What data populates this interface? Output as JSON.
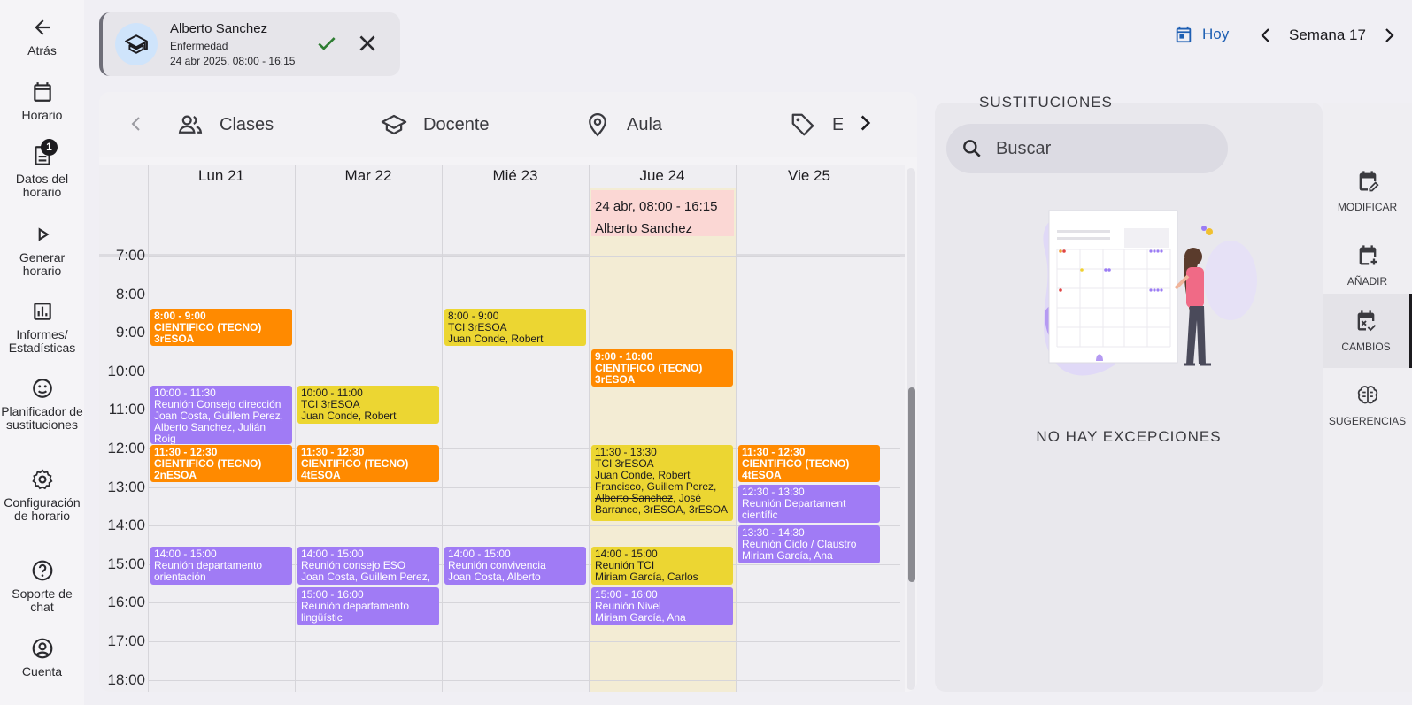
{
  "nav": {
    "back": "Atrás",
    "schedule": "Horario",
    "schedule_data": "Datos del horario",
    "schedule_data_badge": "1",
    "generate": "Generar horario",
    "reports": "Informes/ Estadísticas",
    "planner": "Planificador de sustituciones",
    "config": "Configuración de horario",
    "support": "Soporte de chat",
    "account": "Cuenta"
  },
  "notification": {
    "name": "Alberto Sanchez",
    "reason": "Enfermedad",
    "when": "24 abr 2025, 08:00 - 16:15"
  },
  "toolbar": {
    "today": "Hoy",
    "week": "Semana 17"
  },
  "filters": [
    "Clases",
    "Docente",
    "Aula",
    "Et"
  ],
  "calendar": {
    "days": [
      "Lun 21",
      "Mar 22",
      "Mié 23",
      "Jue 24",
      "Vie 25"
    ],
    "hours": [
      "7:00",
      "8:00",
      "9:00",
      "10:00",
      "11:00",
      "12:00",
      "13:00",
      "14:00",
      "15:00",
      "16:00",
      "17:00",
      "18:00"
    ],
    "allday": {
      "line1": "24 abr, 08:00 - 16:15",
      "line2": "Alberto Sanchez"
    },
    "events": [
      {
        "day": 0,
        "start": 8.37,
        "end": 9.37,
        "color": "orange",
        "lines": [
          "8:00 - 9:00",
          "CIENTIFICO (TECNO)",
          "3rESOA"
        ]
      },
      {
        "day": 0,
        "start": 10.37,
        "end": 11.9,
        "color": "purple",
        "lines": [
          "10:00 - 11:30",
          "Reunión Consejo dirección",
          "Joan Costa, Guillem Perez,",
          "Alberto Sanchez, Julián",
          "Roig"
        ]
      },
      {
        "day": 0,
        "start": 11.9,
        "end": 12.9,
        "color": "orange",
        "lines": [
          "11:30 - 12:30",
          "CIENTIFICO (TECNO)",
          "2nESOA"
        ]
      },
      {
        "day": 0,
        "start": 14.55,
        "end": 15.55,
        "color": "purple",
        "lines": [
          "14:00 - 15:00",
          "Reunión departamento",
          "orientación"
        ]
      },
      {
        "day": 1,
        "start": 10.37,
        "end": 11.37,
        "color": "yellow",
        "lines": [
          "10:00 - 11:00",
          "TCI 3rESOA",
          "Juan Conde, Robert"
        ]
      },
      {
        "day": 1,
        "start": 11.9,
        "end": 12.9,
        "color": "orange",
        "lines": [
          "11:30 - 12:30",
          "CIENTIFICO (TECNO)",
          "4tESOA"
        ]
      },
      {
        "day": 1,
        "start": 14.55,
        "end": 15.55,
        "color": "purple",
        "lines": [
          "14:00 - 15:00",
          "Reunión consejo ESO",
          "Joan Costa, Guillem Perez,"
        ]
      },
      {
        "day": 1,
        "start": 15.6,
        "end": 16.6,
        "color": "purple",
        "lines": [
          "15:00 - 16:00",
          "Reunión departamento",
          "lingüístic"
        ]
      },
      {
        "day": 2,
        "start": 8.37,
        "end": 9.37,
        "color": "yellow",
        "lines": [
          "8:00 - 9:00",
          "TCI 3rESOA",
          "Juan Conde, Robert"
        ]
      },
      {
        "day": 2,
        "start": 14.55,
        "end": 15.55,
        "color": "purple",
        "lines": [
          "14:00 - 15:00",
          "Reunión convivencia",
          "Joan Costa, Alberto"
        ]
      },
      {
        "day": 3,
        "start": 9.42,
        "end": 10.42,
        "color": "orange",
        "lines": [
          "9:00 - 10:00",
          "CIENTIFICO (TECNO)",
          "3rESOA"
        ]
      },
      {
        "day": 3,
        "start": 11.9,
        "end": 13.9,
        "color": "yellow",
        "lines": [
          "11:30 - 13:30",
          "TCI 3rESOA",
          "Juan Conde, Robert",
          "Francisco, Guillem Perez,",
          "~Alberto Sanchez~, José",
          "Barranco, 3rESOA, 3rESOA"
        ]
      },
      {
        "day": 3,
        "start": 14.55,
        "end": 15.55,
        "color": "yellow",
        "lines": [
          "14:00 - 15:00",
          "Reunión TCI",
          "Miriam García, Carlos"
        ]
      },
      {
        "day": 3,
        "start": 15.6,
        "end": 16.6,
        "color": "purple",
        "lines": [
          "15:00 - 16:00",
          "Reunión Nivel",
          "Miriam García, Ana"
        ]
      },
      {
        "day": 4,
        "start": 11.9,
        "end": 12.9,
        "color": "orange",
        "lines": [
          "11:30 - 12:30",
          "CIENTIFICO (TECNO)",
          "4tESOA"
        ]
      },
      {
        "day": 4,
        "start": 12.95,
        "end": 13.95,
        "color": "purple",
        "lines": [
          "12:30 - 13:30",
          "Reunión Departament",
          "científic"
        ]
      },
      {
        "day": 4,
        "start": 14.0,
        "end": 15.0,
        "color": "purple",
        "lines": [
          "13:30 - 14:30",
          "Reunión Ciclo / Claustro",
          "Miriam García, Ana"
        ]
      }
    ]
  },
  "substitutions": {
    "title": "SUSTITUCIONES",
    "search_placeholder": "Buscar",
    "empty": "NO HAY EXCEPCIONES"
  },
  "side_tabs": [
    "MODIFICAR",
    "AÑADIR",
    "CAMBIOS",
    "SUGERENCIAS"
  ]
}
